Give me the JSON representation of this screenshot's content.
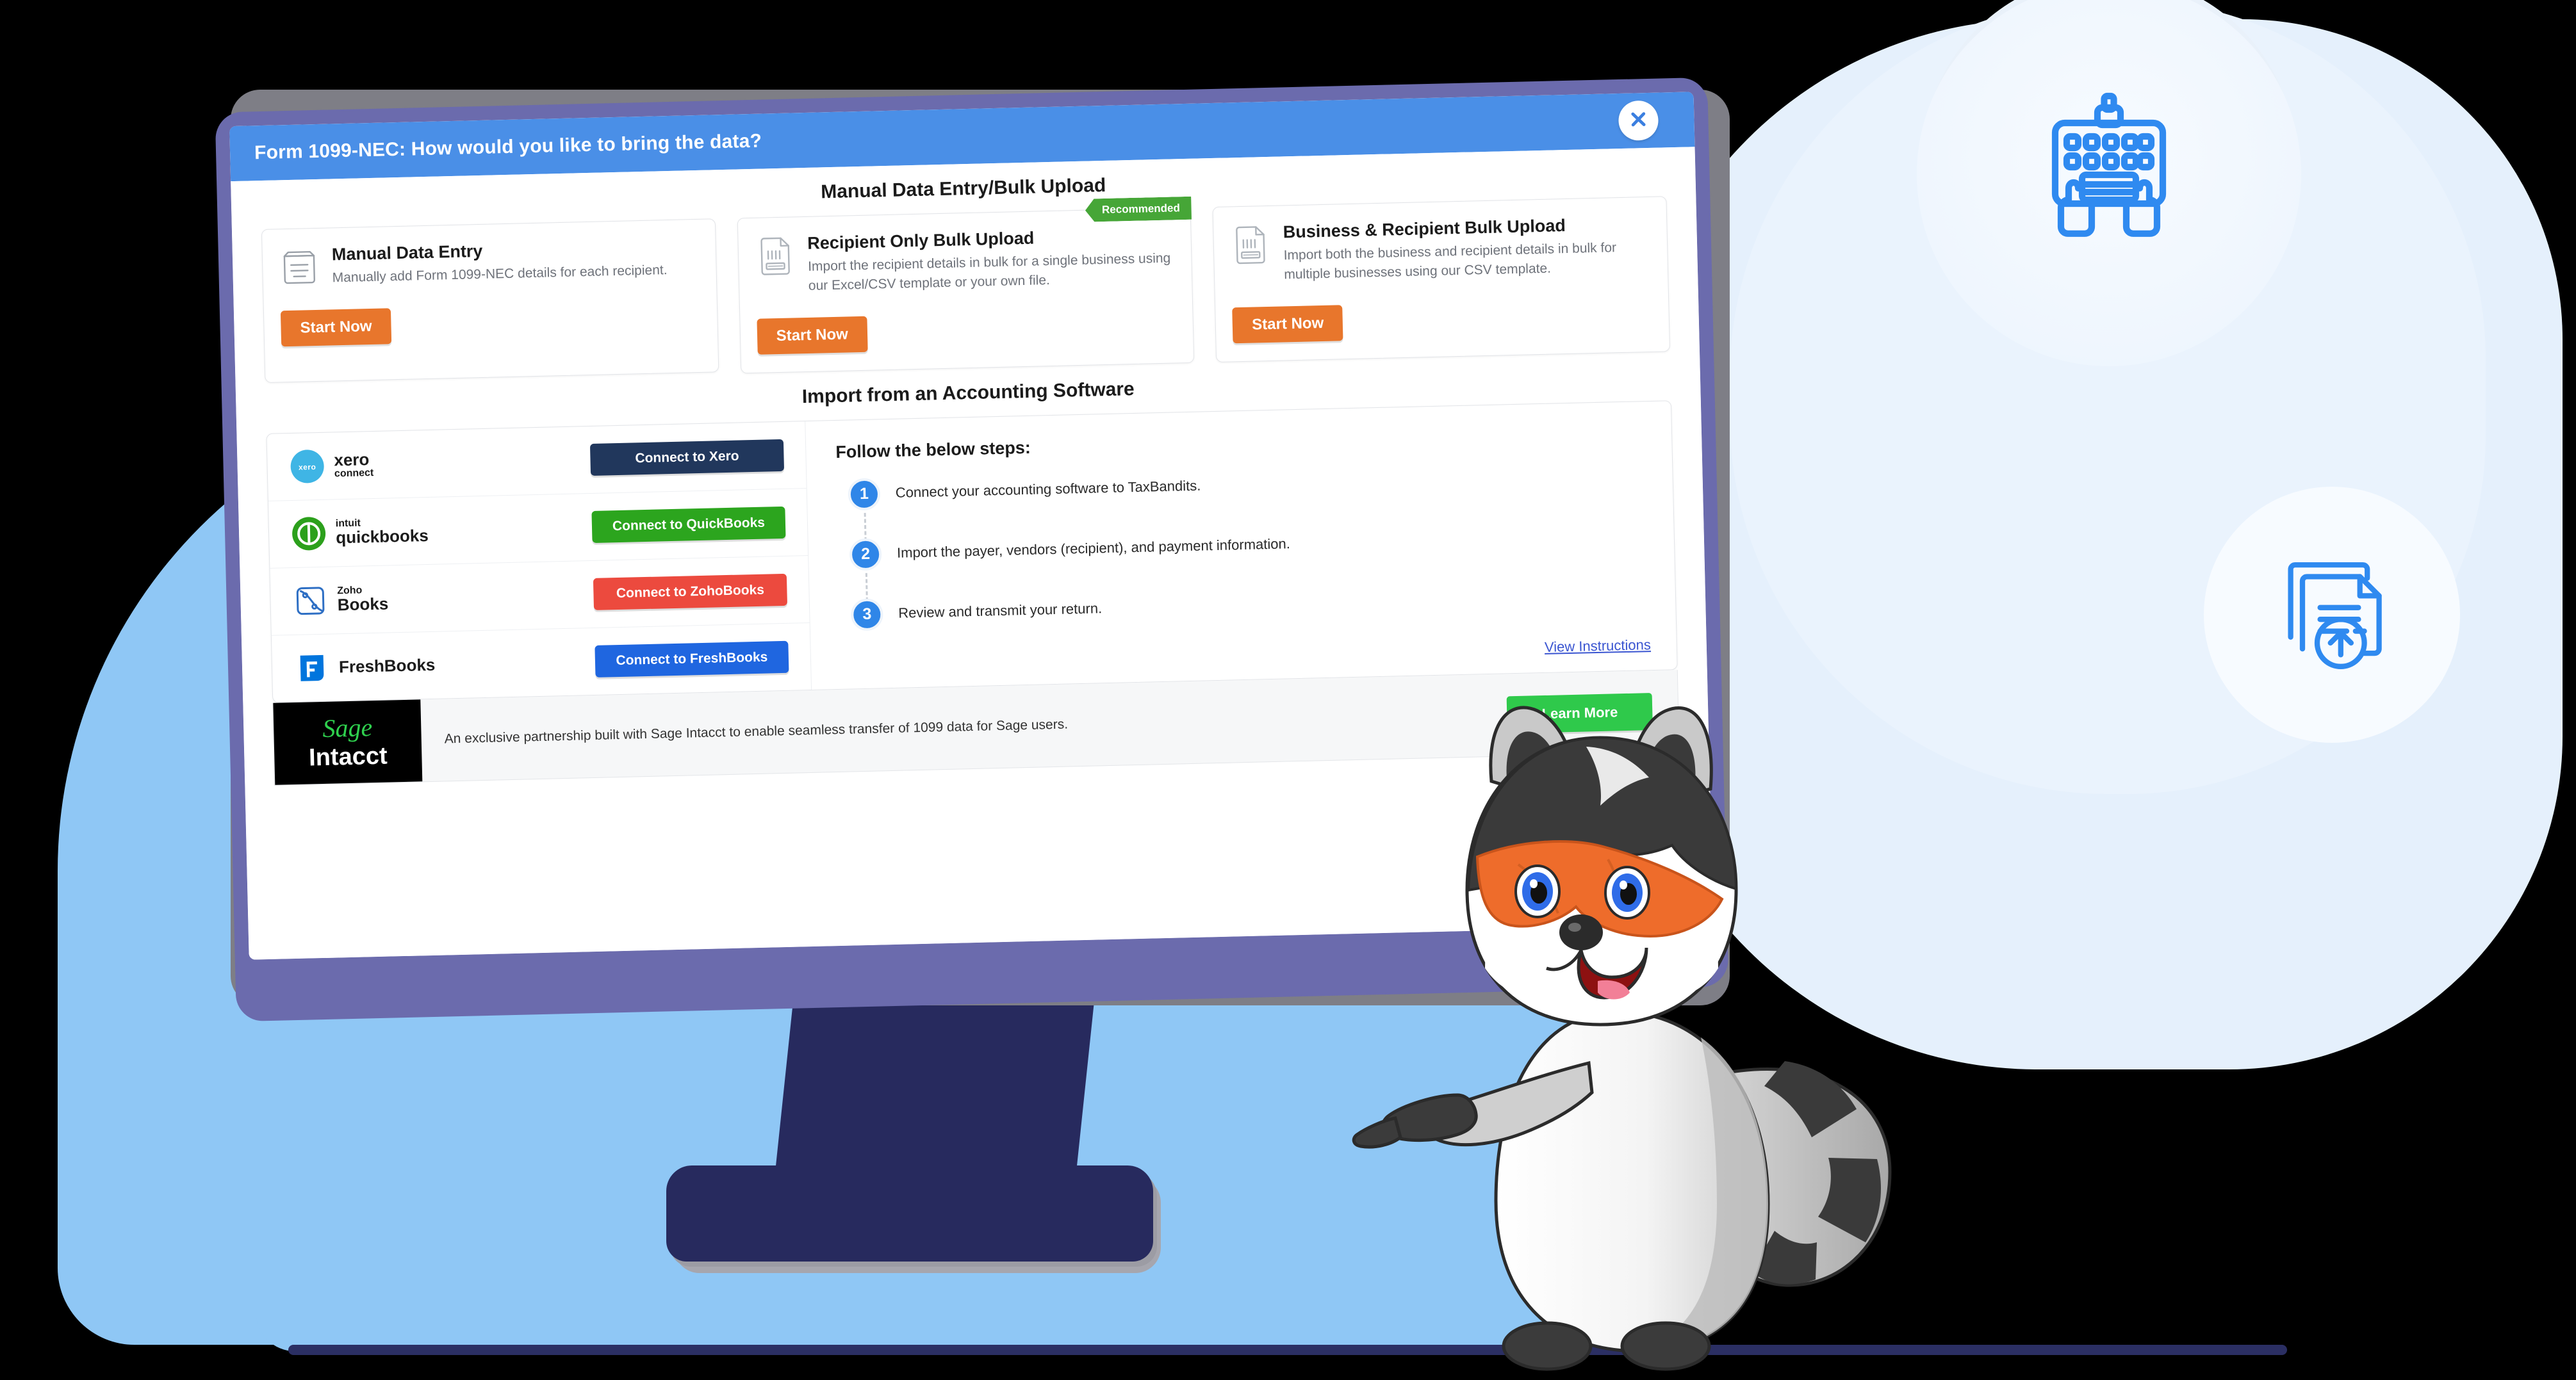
{
  "window": {
    "title": "Form 1099-NEC: How would you like to bring the data?",
    "close_icon": "close-icon",
    "titlebar_color": "#4A8FE7"
  },
  "sections": {
    "manual_heading": "Manual Data Entry/Bulk Upload",
    "accounting_heading": "Import from an Accounting Software"
  },
  "option_cards": [
    {
      "icon": "manual-entry-icon",
      "title": "Manual Data Entry",
      "desc": "Manually add Form 1099-NEC details for each recipient.",
      "button": "Start Now",
      "ribbon": null
    },
    {
      "icon": "csv-file-icon",
      "title": "Recipient Only Bulk Upload",
      "desc": "Import the recipient details in bulk for a single business using our Excel/CSV template or your own file.",
      "button": "Start Now",
      "ribbon": "Recommended"
    },
    {
      "icon": "csv-file-icon",
      "title": "Business & Recipient Bulk Upload",
      "desc": "Import both the business and recipient details in bulk for multiple businesses using our CSV template.",
      "button": "Start Now",
      "ribbon": null
    }
  ],
  "software": [
    {
      "name": "xero",
      "sub": "connect",
      "icon": "xero-logo-icon",
      "button": "Connect to Xero",
      "color": "#21375C"
    },
    {
      "name": "quickbooks",
      "sub": "intuit",
      "icon": "quickbooks-logo-icon",
      "button": "Connect to QuickBooks",
      "color": "#2CA51E"
    },
    {
      "name": "Books",
      "sub": "Zoho",
      "icon": "zohobooks-logo-icon",
      "button": "Connect to ZohoBooks",
      "color": "#EC4A3E"
    },
    {
      "name": "FreshBooks",
      "sub": "",
      "icon": "freshbooks-logo-icon",
      "button": "Connect to FreshBooks",
      "color": "#1F66E0"
    }
  ],
  "steps": {
    "title": "Follow the below steps:",
    "items": [
      {
        "num": "1",
        "text": "Connect your accounting software to TaxBandits."
      },
      {
        "num": "2",
        "text": "Import the payer, vendors (recipient), and payment information."
      },
      {
        "num": "3",
        "text": "Review and transmit your return."
      }
    ],
    "view_instructions": "View Instructions"
  },
  "sage_banner": {
    "logo_top": "Sage",
    "logo_bottom": "Intacct",
    "text": "An exclusive partnership built with Sage Intacct to enable seamless transfer of 1099 data for Sage users.",
    "button": "Learn More",
    "button_color": "#2FC94B"
  },
  "decor": {
    "badge_keyboard_icon": "keyboard-typing-icon",
    "badge_upload_icon": "document-upload-icon",
    "mascot": "raccoon-mascot"
  },
  "colors": {
    "accent_orange": "#E8762C",
    "titlebar_blue": "#4A8FE7",
    "monitor_bezel": "#6B6BAD",
    "bg_blue": "#8FC7F5",
    "bg_light": "#E5F0FC",
    "ribbon_green": "#46A637"
  }
}
